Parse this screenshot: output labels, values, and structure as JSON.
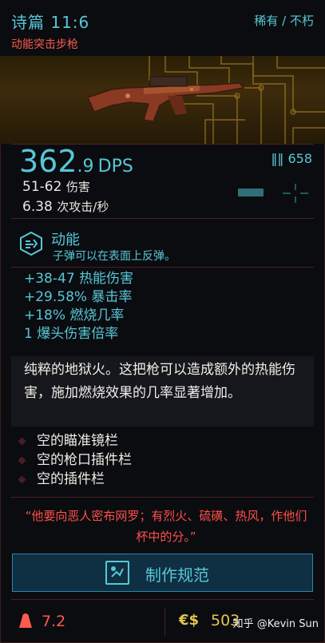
{
  "header": {
    "title": "诗篇 11:6",
    "rarity": "稀有 / 不朽",
    "weapon_type": "动能突击步枪"
  },
  "stats": {
    "dps_int": "362",
    "dps_dec": ".9",
    "dps_unit": "DPS",
    "ammo": "658",
    "damage_value": "51-62",
    "damage_label": "伤害",
    "aps_value": "6.38",
    "aps_label": "次攻击/秒"
  },
  "ability": {
    "name": "动能",
    "description": "子弹可以在表面上反弹。"
  },
  "modifiers": [
    {
      "value": "+38-47",
      "label": "热能伤害"
    },
    {
      "value": "+29.58%",
      "label": "暴击率"
    },
    {
      "value": "+18%",
      "label": "燃烧几率"
    },
    {
      "value": "1",
      "label": "爆头伤害倍率"
    }
  ],
  "description": "纯粹的地狱火。这把枪可以造成额外的热能伤害，施加燃烧效果的几率显著增加。",
  "slots": [
    {
      "label": "空的瞄准镜栏"
    },
    {
      "label": "空的枪口插件栏"
    },
    {
      "label": "空的插件栏"
    }
  ],
  "quote": "“他要向恶人密布网罗；有烈火、硫磺、热风，作他们杯中的分。”",
  "craft_button": {
    "label": "制作规范"
  },
  "footer": {
    "weight": "7.2",
    "currency_symbol": "€$",
    "price": "503",
    "watermark": "知乎 @Kevin Sun"
  },
  "colors": {
    "accent": "#57c7d6",
    "danger": "#ff5a4f",
    "money": "#e1c750",
    "background": "#0b0c10"
  },
  "icons": [
    "ammo-icon",
    "scope-icon",
    "crosshair-icon",
    "kinetic-ability-icon",
    "craft-icon",
    "weight-icon",
    "currency-icon"
  ]
}
